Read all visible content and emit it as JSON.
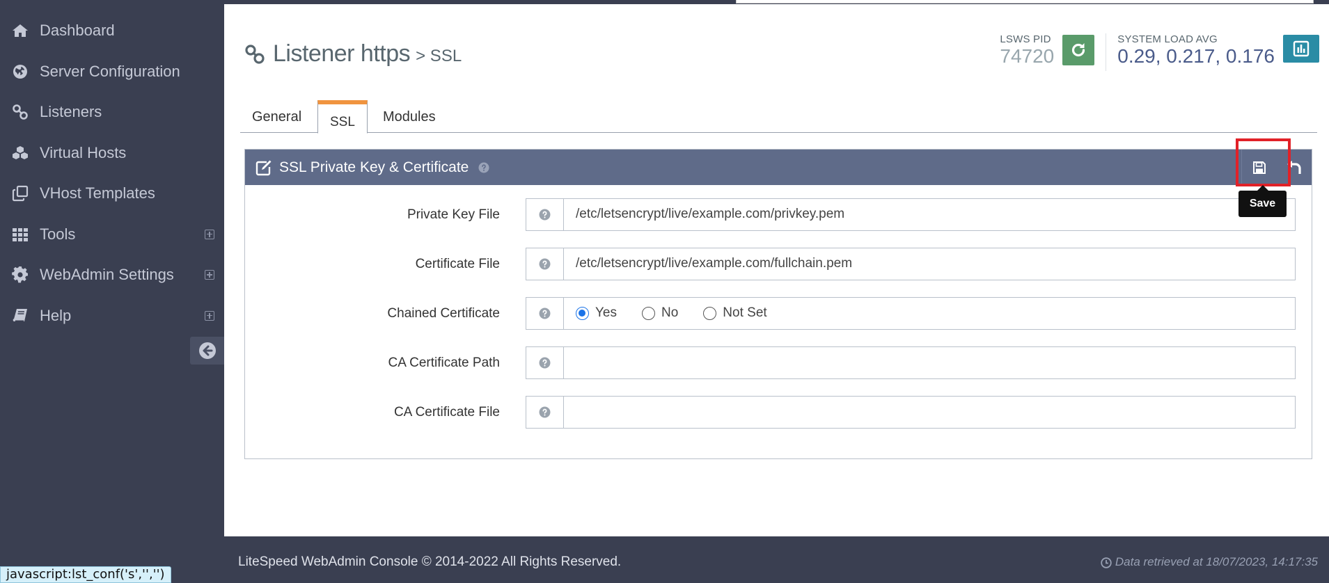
{
  "sidebar": {
    "items": [
      {
        "label": "Dashboard",
        "icon": "home-icon",
        "expandable": false
      },
      {
        "label": "Server Configuration",
        "icon": "globe-icon",
        "expandable": false
      },
      {
        "label": "Listeners",
        "icon": "link-icon",
        "expandable": false
      },
      {
        "label": "Virtual Hosts",
        "icon": "cubes-icon",
        "expandable": false
      },
      {
        "label": "VHost Templates",
        "icon": "clone-icon",
        "expandable": false
      },
      {
        "label": "Tools",
        "icon": "grid-icon",
        "expandable": true
      },
      {
        "label": "WebAdmin Settings",
        "icon": "gear-icon",
        "expandable": true
      },
      {
        "label": "Help",
        "icon": "book-icon",
        "expandable": true
      }
    ]
  },
  "header": {
    "title": "Listener https",
    "subtitle": "> SSL"
  },
  "stats": {
    "pid_label": "LSWS PID",
    "pid_value": "74720",
    "load_label": "SYSTEM LOAD AVG",
    "load_value": "0.29, 0.217, 0.176"
  },
  "tabs": [
    {
      "label": "General",
      "active": false
    },
    {
      "label": "SSL",
      "active": true
    },
    {
      "label": "Modules",
      "active": false
    }
  ],
  "panel": {
    "title": "SSL Private Key & Certificate",
    "save_tooltip": "Save",
    "fields": [
      {
        "label": "Private Key File",
        "value": "/etc/letsencrypt/live/example.com/privkey.pem"
      },
      {
        "label": "Certificate File",
        "value": "/etc/letsencrypt/live/example.com/fullchain.pem"
      },
      {
        "label": "Chained Certificate",
        "options": [
          "Yes",
          "No",
          "Not Set"
        ],
        "selected": "Yes"
      },
      {
        "label": "CA Certificate Path",
        "value": ""
      },
      {
        "label": "CA Certificate File",
        "value": ""
      }
    ]
  },
  "footer": {
    "copyright": "LiteSpeed WebAdmin Console © 2014-2022 All Rights Reserved.",
    "retrieved": "Data retrieved at 18/07/2023, 14:17:35"
  },
  "status_url": "javascript:lst_conf('s','','')",
  "colors": {
    "sidebar_bg": "#3a3f51",
    "panel_heading_bg": "#5f6b89",
    "active_tab_accent": "#f0943f",
    "reload_button": "#5a9b6a",
    "chart_button": "#2a8ca5",
    "highlight": "#e12128"
  }
}
